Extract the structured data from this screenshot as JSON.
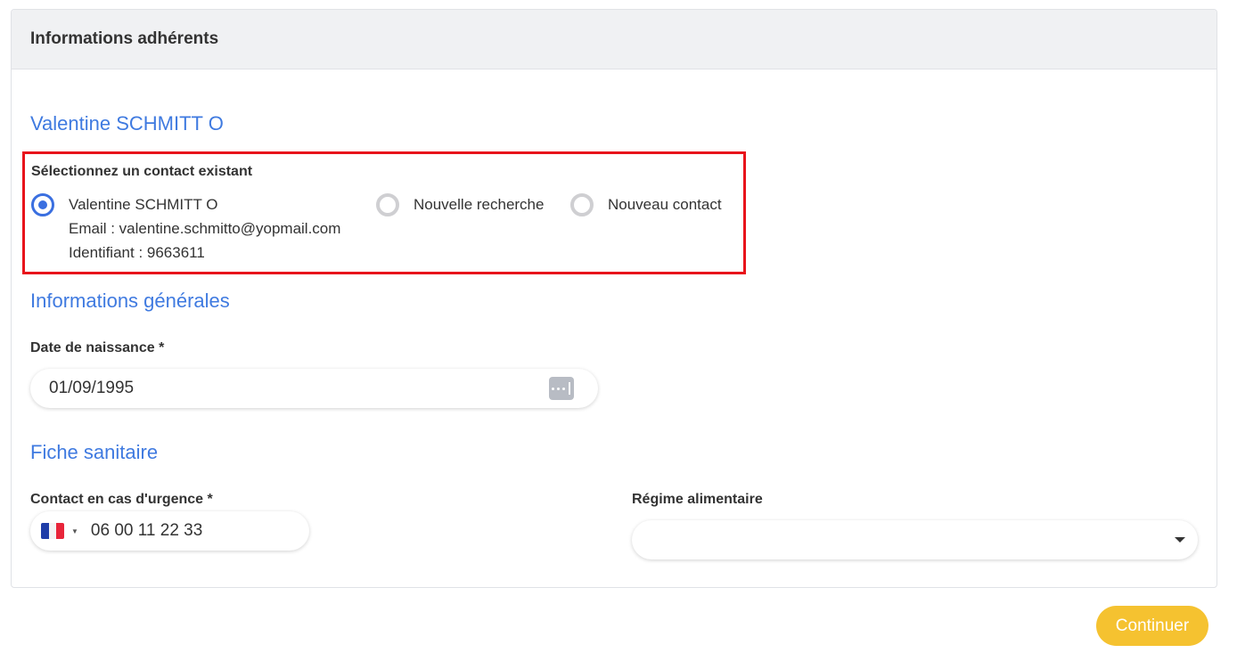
{
  "card": {
    "title": "Informations adhérents"
  },
  "member": {
    "name": "Valentine SCHMITT O"
  },
  "contact_select": {
    "title": "Sélectionnez un contact existant",
    "options": [
      {
        "label": "Valentine SCHMITT O",
        "email": "Email : valentine.schmitto@yopmail.com",
        "identifier": "Identifiant : 9663611",
        "selected": true
      },
      {
        "label": "Nouvelle recherche",
        "selected": false
      },
      {
        "label": "Nouveau contact",
        "selected": false
      }
    ]
  },
  "general": {
    "heading": "Informations générales",
    "birth_label": "Date de naissance *",
    "birth_value": "01/09/1995"
  },
  "health": {
    "heading": "Fiche sanitaire",
    "emergency_label": "Contact en cas d'urgence *",
    "emergency_value": "06 00 11 22 33",
    "diet_label": "Régime alimentaire",
    "diet_value": ""
  },
  "actions": {
    "continue_label": "Continuer"
  },
  "colors": {
    "accent_blue": "#3f7ae0",
    "highlight_red": "#e8141b",
    "button_yellow": "#f5c230"
  },
  "icons": {
    "calendar": "calendar-icon",
    "flag": "france-flag-icon",
    "dropdown": "caret-down-icon"
  }
}
